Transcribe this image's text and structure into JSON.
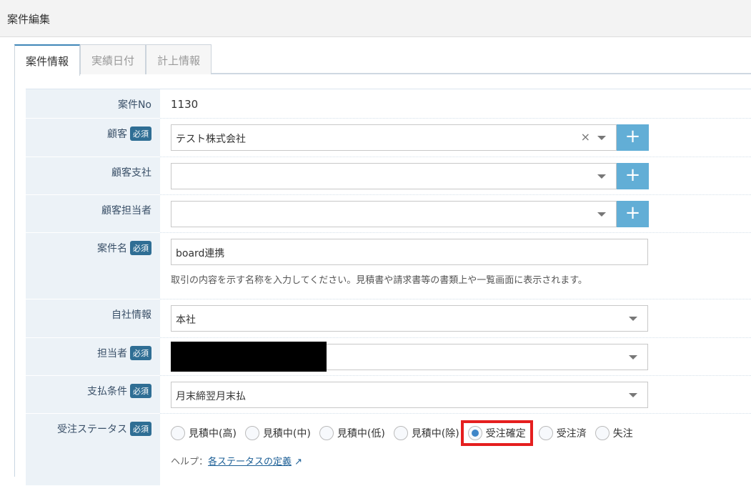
{
  "header": {
    "title": "案件編集"
  },
  "tabs": [
    {
      "label": "案件情報"
    },
    {
      "label": "実績日付"
    },
    {
      "label": "計上情報"
    }
  ],
  "required_badge": "必須",
  "fields": {
    "case_no": {
      "label": "案件No",
      "value": "1130"
    },
    "customer": {
      "label": "顧客",
      "value": "テスト株式会社"
    },
    "customer_branch": {
      "label": "顧客支社",
      "value": ""
    },
    "customer_contact": {
      "label": "顧客担当者",
      "value": ""
    },
    "case_name": {
      "label": "案件名",
      "value": "board連携",
      "hint": "取引の内容を示す名称を入力してください。見積書や請求書等の書類上や一覧画面に表示されます。"
    },
    "company": {
      "label": "自社情報",
      "value": "本社"
    },
    "staff": {
      "label": "担当者",
      "value": ""
    },
    "payment": {
      "label": "支払条件",
      "value": "月末締翌月末払"
    },
    "status": {
      "label": "受注ステータス",
      "options": [
        "見積中(高)",
        "見積中(中)",
        "見積中(低)",
        "見積中(除)",
        "受注確定",
        "受注済",
        "失注"
      ],
      "selected": "受注確定",
      "help_prefix": "ヘルプ：",
      "help_link": "各ステータスの定義"
    }
  },
  "icons": {
    "clear": "×",
    "plus": "+",
    "external": "↗"
  }
}
